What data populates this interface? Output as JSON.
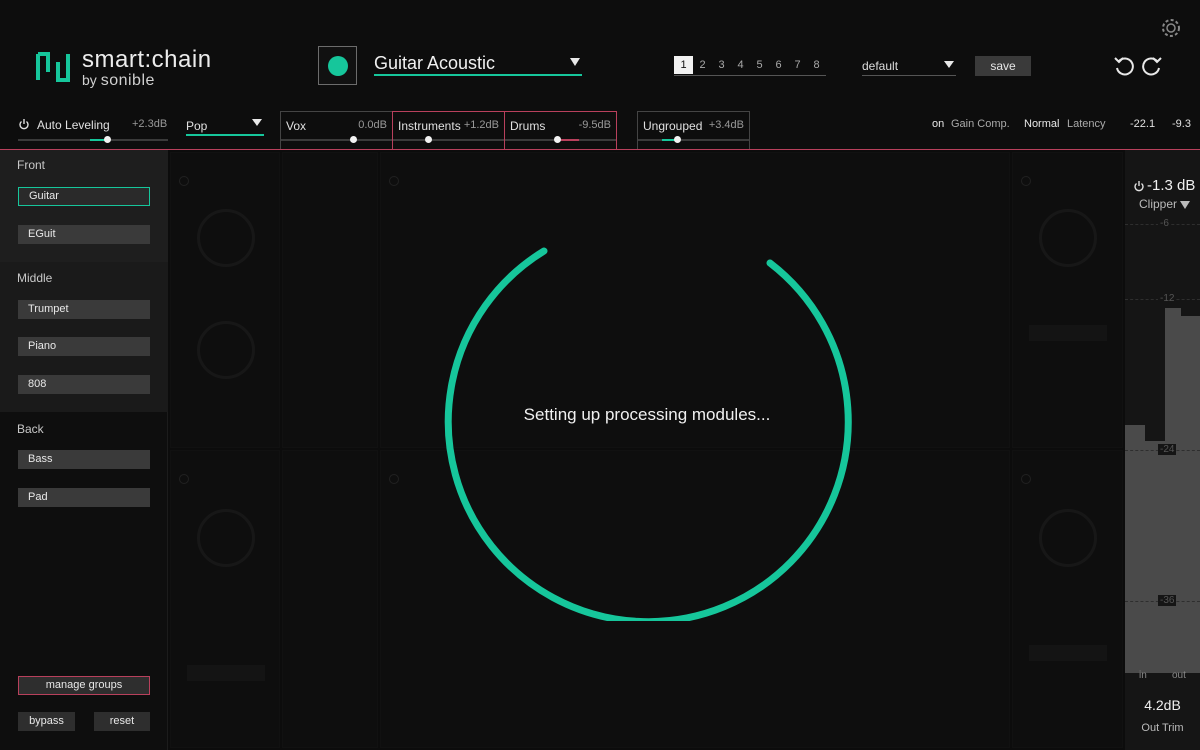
{
  "app": {
    "logo_text": "smart:chain",
    "logo_by": "by",
    "logo_brand": "sonible"
  },
  "header": {
    "profile": "Guitar Acoustic",
    "slots": [
      "1",
      "2",
      "3",
      "4",
      "5",
      "6",
      "7",
      "8"
    ],
    "active_slot": "1",
    "preset": "default",
    "save_label": "save"
  },
  "groupbar": {
    "auto_leveling_label": "Auto Leveling",
    "auto_leveling_value": "+2.3dB",
    "genre": "Pop",
    "groups": [
      {
        "name": "Vox",
        "value": "0.0dB",
        "level": 0.6
      },
      {
        "name": "Instruments",
        "value": "+1.2dB",
        "level": 0.3
      },
      {
        "name": "Drums",
        "value": "-9.5dB",
        "level": 0.5
      },
      {
        "name": "Ungrouped",
        "value": "+3.4dB",
        "level": 0.35
      }
    ],
    "gain_comp_state": "on",
    "gain_comp_label": "Gain Comp.",
    "latency_state": "Normal",
    "latency_label": "Latency",
    "meter_left": "-22.1",
    "meter_right": "-9.3"
  },
  "sidebar": {
    "sections": [
      {
        "title": "Front",
        "tracks": [
          "Guitar",
          "EGuit"
        ]
      },
      {
        "title": "Middle",
        "tracks": [
          "Trumpet",
          "Piano",
          "808"
        ]
      },
      {
        "title": "Back",
        "tracks": [
          "Bass",
          "Pad"
        ]
      }
    ],
    "selected_track": "Guitar",
    "manage_groups_label": "manage groups",
    "bypass_label": "bypass",
    "reset_label": "reset"
  },
  "loader": {
    "message": "Setting up processing modules..."
  },
  "meter_panel": {
    "db": "-1.3 dB",
    "mode": "Clipper",
    "scale": [
      "-6",
      "-12",
      "-24",
      "-36"
    ],
    "in_label": "in",
    "out_label": "out",
    "trim_value": "4.2dB",
    "trim_label": "Out Trim"
  },
  "colors": {
    "accent": "#16c69b",
    "warning": "#b8405c"
  }
}
